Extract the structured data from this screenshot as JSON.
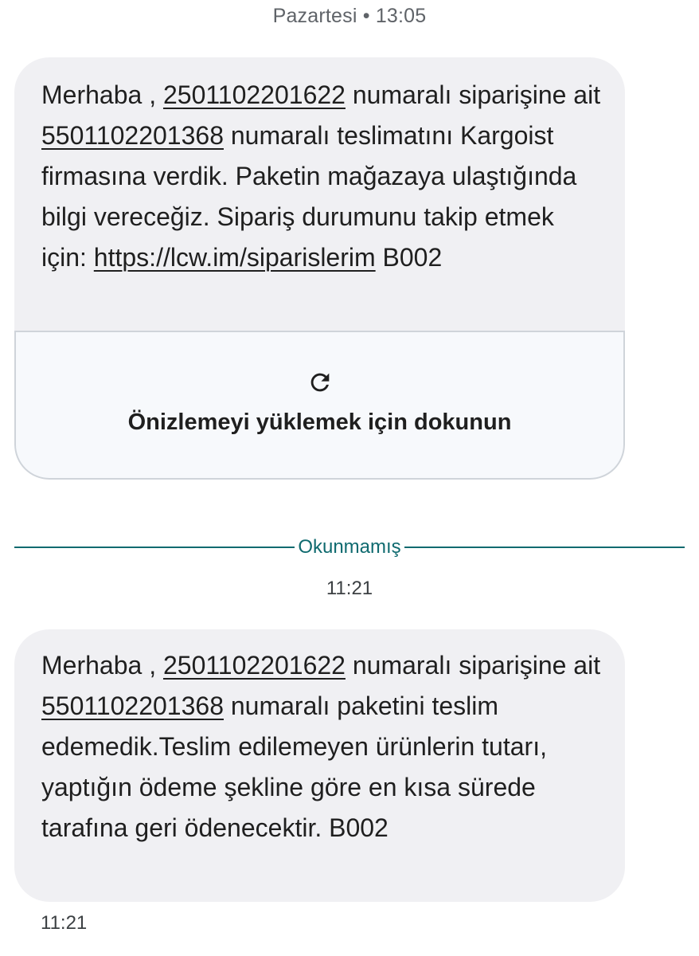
{
  "header": {
    "date_label": "Pazartesi • 13:05"
  },
  "messages": [
    {
      "parts": [
        "Merhaba , ",
        "2501102201622",
        " numaralı siparişine ait ",
        "5501102201368",
        " numaralı teslimatını Kargoist firmasına verdik. Paketin mağazaya ulaştığında bilgi vereceğiz. Sipariş durumunu takip etmek için: ",
        "https://lcw.im/siparislerim",
        " B002"
      ],
      "preview": {
        "icon": "refresh-icon",
        "label": "Önizlemeyi yüklemek için dokunun"
      }
    },
    {
      "parts": [
        "Merhaba  , ",
        "2501102201622",
        " numaralı siparişine ait ",
        "5501102201368",
        " numaralı paketini teslim edemedik.Teslim edilemeyen ürünlerin tutarı, yaptığın ödeme şekline göre en kısa sürede tarafına geri ödenecektir. B002"
      ],
      "timestamp": "11:21"
    }
  ],
  "divider": {
    "label": "Okunmamış",
    "color": "#0f6a6f"
  },
  "group_time": "11:21"
}
